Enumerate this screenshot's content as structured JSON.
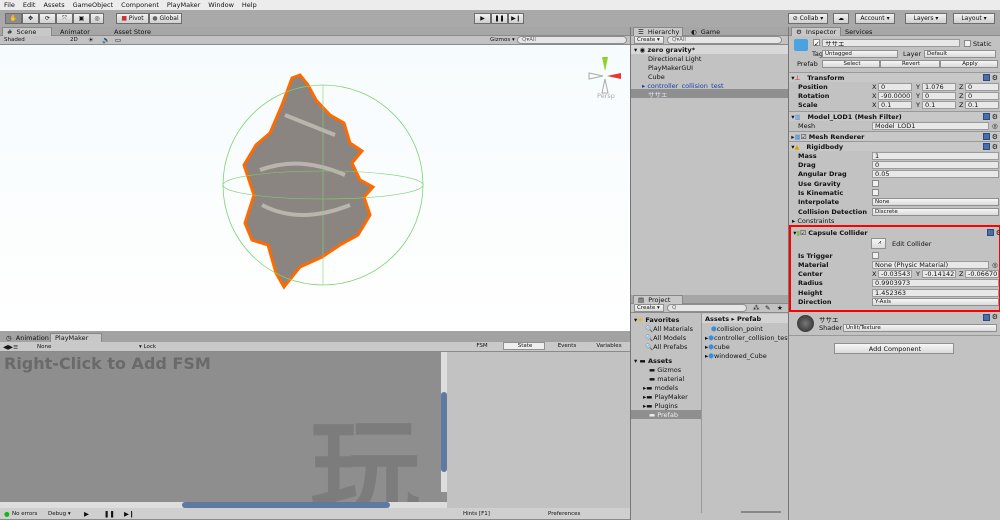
{
  "menu": [
    "File",
    "Edit",
    "Assets",
    "GameObject",
    "Component",
    "PlayMaker",
    "Window",
    "Help"
  ],
  "toolbar": {
    "pivot": "Pivot",
    "global": "Global",
    "collab": "Collab",
    "account": "Account",
    "layers": "Layers",
    "layout": "Layout",
    "tools": [
      "hand-icon",
      "move-icon",
      "rotate-icon",
      "scale-icon",
      "rect-icon",
      "transform-icon"
    ]
  },
  "scene": {
    "tabs": [
      "Scene",
      "Animator",
      "Asset Store"
    ],
    "shading": "Shaded",
    "mode_2d": "2D",
    "gizmos": "Gizmos",
    "search": "All",
    "persp": "Persp"
  },
  "hierarchy": {
    "tabs": [
      "Hierarchy",
      "Game"
    ],
    "create": "Create",
    "search": "All",
    "scene": "zero gravity*",
    "items": [
      "Directional Light",
      "PlayMakerGUI",
      "Cube",
      "controller_collision_test",
      "ササエ"
    ]
  },
  "project": {
    "tab": "Project",
    "create": "Create",
    "favorites_label": "Favorites",
    "favorites": [
      "All Materials",
      "All Models",
      "All Prefabs"
    ],
    "assets_label": "Assets",
    "folders": [
      "Gizmos",
      "material",
      "models",
      "PlayMaker",
      "Plugins",
      "Prefab"
    ],
    "breadcrumb": [
      "Assets",
      "Prefab"
    ],
    "files": [
      "collision_point",
      "controller_collision_test",
      "cube",
      "windowed_Cube"
    ]
  },
  "inspector": {
    "tabs": [
      "Inspector",
      "Services"
    ],
    "name": "ササエ",
    "static": "Static",
    "tag_label": "Tag",
    "tag": "Untagged",
    "layer_label": "Layer",
    "layer": "Default",
    "prefab_label": "Prefab",
    "select": "Select",
    "revert": "Revert",
    "apply": "Apply",
    "transform": {
      "title": "Transform",
      "position_label": "Position",
      "rotation_label": "Rotation",
      "scale_label": "Scale",
      "position": [
        "0",
        "1.076",
        "0"
      ],
      "rotation": [
        "-90.0000",
        "0",
        "0"
      ],
      "scale": [
        "0.1",
        "0.1",
        "0.1"
      ]
    },
    "mesh_filter": {
      "title": "Model_LOD1 (Mesh Filter)",
      "mesh_label": "Mesh",
      "mesh": "Model_LOD1"
    },
    "mesh_renderer": {
      "title": "Mesh Renderer"
    },
    "rigidbody": {
      "title": "Rigidbody",
      "mass_label": "Mass",
      "mass": "1",
      "drag_label": "Drag",
      "drag": "0",
      "angular_drag_label": "Angular Drag",
      "angular_drag": "0.05",
      "use_gravity_label": "Use Gravity",
      "is_kinematic_label": "Is Kinematic",
      "interpolate_label": "Interpolate",
      "interpolate": "None",
      "collision_label": "Collision Detection",
      "collision": "Discrete",
      "constraints": "Constraints"
    },
    "capsule": {
      "title": "Capsule Collider",
      "edit": "Edit Collider",
      "trigger_label": "Is Trigger",
      "material_label": "Material",
      "material": "None (Physic Material)",
      "center_label": "Center",
      "center": [
        "-0.03543",
        "-0.14142",
        "-0.06670"
      ],
      "radius_label": "Radius",
      "radius": "0.9903973",
      "height_label": "Height",
      "height": "1.452363",
      "direction_label": "Direction",
      "direction": "Y-Axis",
      "highlight_color": "#ff0000"
    },
    "material": {
      "name": "ササエ",
      "shader_label": "Shader",
      "shader": "Unlit/Texture"
    },
    "add_component": "Add Component"
  },
  "playmaker": {
    "tabs": [
      "Animation",
      "PlayMaker"
    ],
    "fsm_select": "None",
    "lock": "Lock",
    "hint": "Right-Click to Add FSM",
    "watermark": "玩",
    "side_tabs": [
      "FSM",
      "State",
      "Events",
      "Variables"
    ],
    "status": "No errors",
    "debug": "Debug",
    "hints": "Hints [F1]",
    "preferences": "Preferences"
  }
}
